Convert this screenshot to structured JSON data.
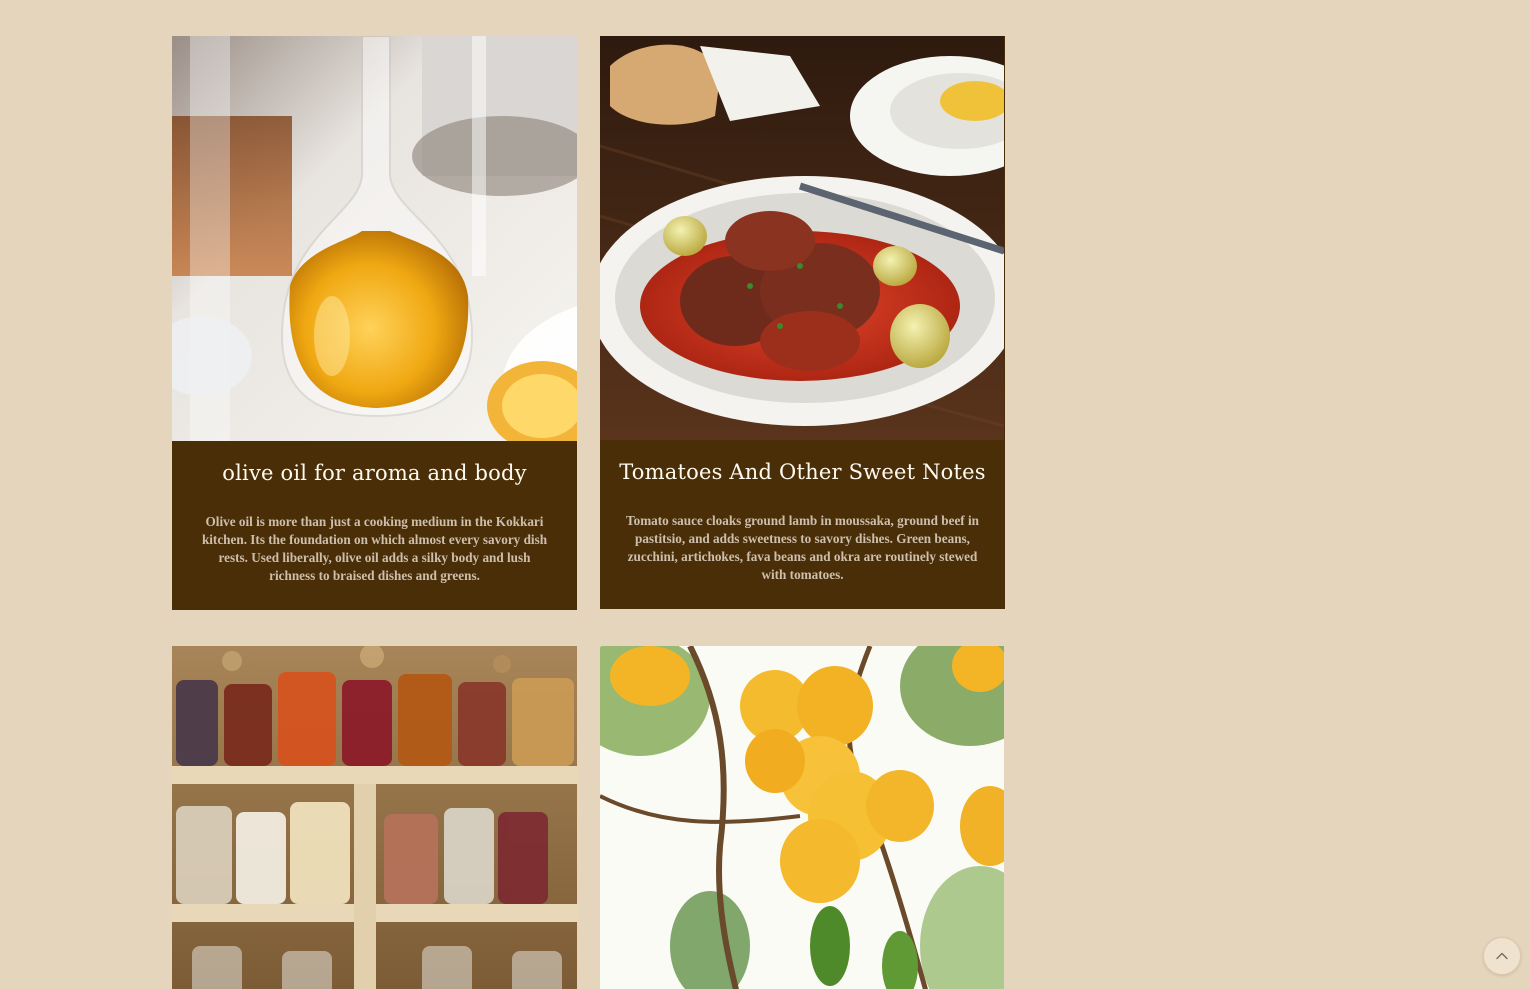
{
  "cards": [
    {
      "title": "olive oil for aroma and body",
      "description": "Olive oil is more than just a cooking medium in the Kokkari kitchen. Its the foundation on which almost every savory dish rests. Used liberally, olive oil adds a silky body and lush richness to braised dishes and greens.",
      "image": "olive-oil-carafe-photo"
    },
    {
      "title": "Tomatoes And Other Sweet Notes",
      "description": "Tomato sauce cloaks ground lamb in moussaka, ground beef in pastitsio, and adds sweetness to savory dishes. Green beans, zucchini, artichokes, fava beans and okra are routinely stewed with tomatoes.",
      "image": "tomato-stew-plate-photo"
    },
    {
      "image": "pantry-jars-photo"
    },
    {
      "image": "lemon-tree-photo"
    }
  ],
  "scroll_top": {
    "icon": "chevron-up-icon"
  },
  "colors": {
    "page_background": "#e6d5bd",
    "caption_background": "#4a2e08",
    "title_text": "#fffaf0",
    "description_text": "#cdbfad"
  }
}
